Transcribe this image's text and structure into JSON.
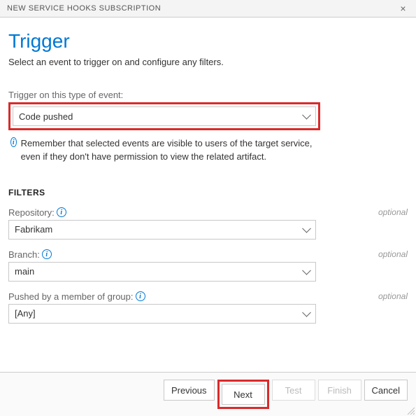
{
  "header": {
    "title": "NEW SERVICE HOOKS SUBSCRIPTION"
  },
  "page": {
    "heading": "Trigger",
    "subtitle": "Select an event to trigger on and configure any filters."
  },
  "trigger": {
    "label": "Trigger on this type of event:",
    "value": "Code pushed",
    "note": "Remember that selected events are visible to users of the target service, even if they don't have permission to view the related artifact."
  },
  "filters": {
    "heading": "FILTERS",
    "optional_text": "optional",
    "items": [
      {
        "label": "Repository:",
        "value": "Fabrikam"
      },
      {
        "label": "Branch:",
        "value": "main"
      },
      {
        "label": "Pushed by a member of group:",
        "value": "[Any]"
      }
    ]
  },
  "buttons": {
    "previous": "Previous",
    "next": "Next",
    "test": "Test",
    "finish": "Finish",
    "cancel": "Cancel"
  }
}
